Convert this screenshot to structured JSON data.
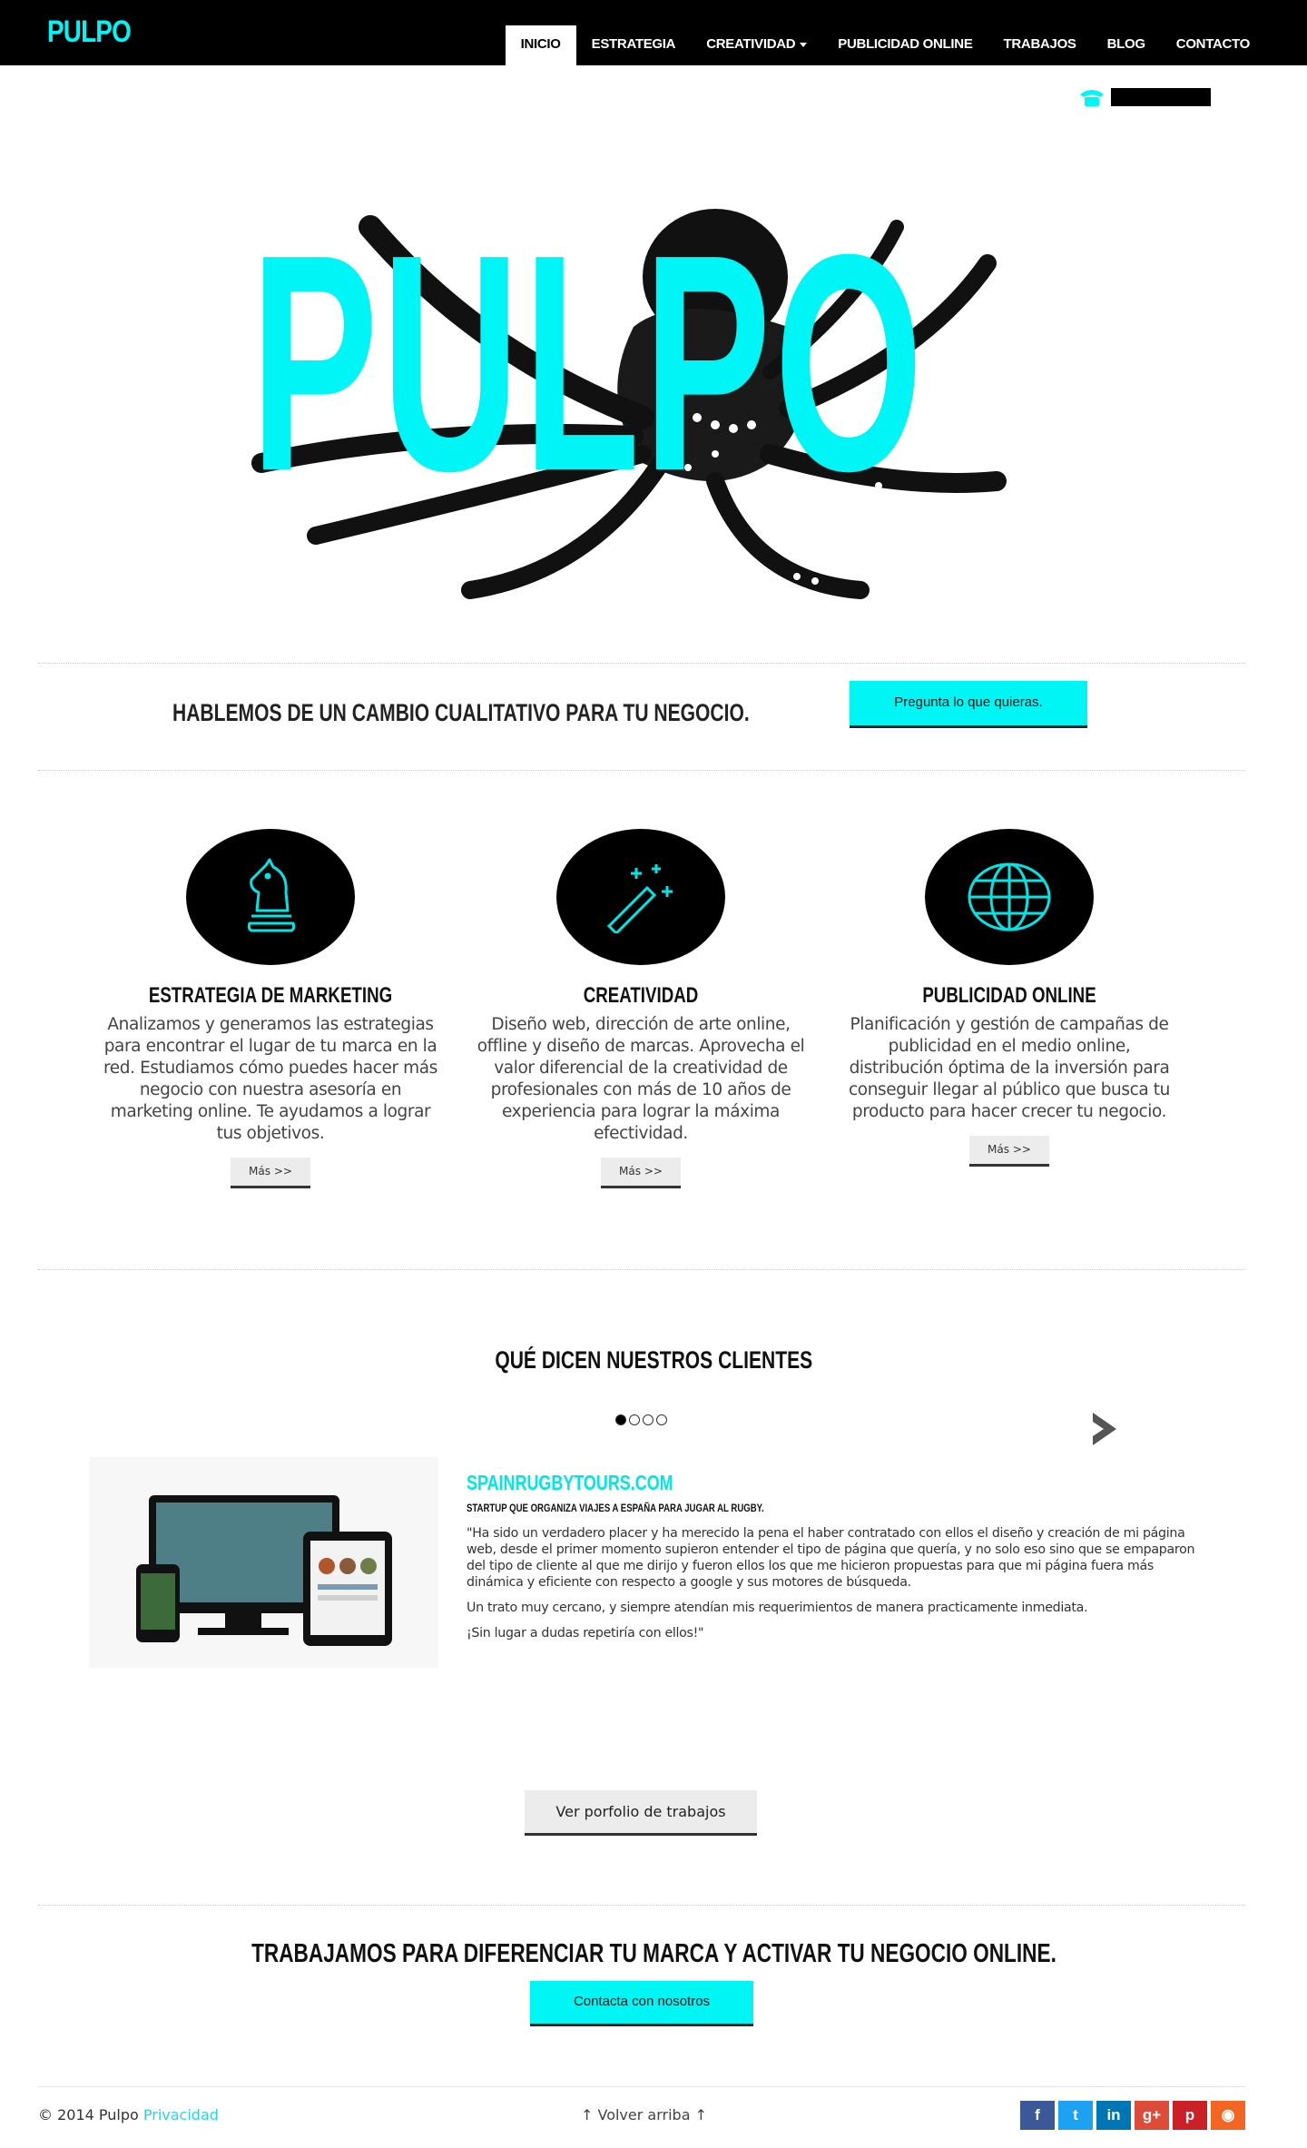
{
  "brand": "PULPO",
  "nav": {
    "items": [
      {
        "label": "INICIO",
        "active": true
      },
      {
        "label": "ESTRATEGIA"
      },
      {
        "label": "CREATIVIDAD",
        "dropdown": true
      },
      {
        "label": "PUBLICIDAD ONLINE"
      },
      {
        "label": "TRABAJOS"
      },
      {
        "label": "BLOG"
      },
      {
        "label": "CONTACTO"
      }
    ]
  },
  "hero": {
    "word": "PULPO"
  },
  "cta": {
    "text": "HABLEMOS DE UN CAMBIO CUALITATIVO PARA TU NEGOCIO.",
    "button": "Pregunta lo que quieras."
  },
  "services": [
    {
      "icon": "chess-knight-icon",
      "title": "ESTRATEGIA DE MARKETING",
      "desc": "Analizamos y generamos las estrategias para encontrar el lugar de tu marca en la red. Estudiamos cómo puedes hacer más negocio con nuestra asesoría en marketing online. Te ayudamos a lograr tus objetivos.",
      "button": "Más >>"
    },
    {
      "icon": "magic-wand-icon",
      "title": "CREATIVIDAD",
      "desc": "Diseño web, dirección de arte online, offline y diseño de marcas. Aprovecha el valor diferencial de la creatividad de profesionales con más de 10 años de experiencia para lograr la máxima efectividad.",
      "button": "Más >>"
    },
    {
      "icon": "globe-icon",
      "title": "PUBLICIDAD ONLINE",
      "desc": "Planificación y gestión de campañas de publicidad en el medio online, distribución óptima de la inversión para conseguir llegar al público que busca tu producto para hacer crecer tu negocio.",
      "button": "Más >>"
    }
  ],
  "testimonials": {
    "title": "QUÉ DICEN NUESTROS CLIENTES",
    "site": "SPAINRUGBYTOURS.COM",
    "subtitle": "STARTUP QUE ORGANIZA VIAJES A ESPAÑA PARA JUGAR AL RUGBY.",
    "quote": [
      "\"Ha sido un verdadero placer y ha merecido la pena el haber contratado con ellos el diseño y creación de mi página web, desde el primer momento supieron entender el tipo de página que quería, y no solo eso sino que se empaparon del tipo de cliente al que me dirijo y fueron ellos los que me hicieron propuestas para que mi página fuera más dinámica y eficiente con respecto a google y sus motores de búsqueda.",
      "Un trato muy cercano, y siempre atendían mis requerimientos de manera practicamente inmediata.",
      "¡Sin lugar a dudas repetiría con ellos!\""
    ],
    "portfolio_button": "Ver porfolio de trabajos"
  },
  "bottom": {
    "title": "TRABAJAMOS PARA DIFERENCIAR TU MARCA Y ACTIVAR TU NEGOCIO ONLINE.",
    "button": "Contacta con nosotros"
  },
  "footer": {
    "copyright": "© 2014 Pulpo",
    "privacy": "Privacidad",
    "back_to_top": "↑ Volver arriba ↑",
    "social": [
      {
        "name": "facebook-icon",
        "glyph": "f",
        "color": "#3b5998"
      },
      {
        "name": "twitter-icon",
        "glyph": "t",
        "color": "#1da1f2"
      },
      {
        "name": "linkedin-icon",
        "glyph": "in",
        "color": "#0077b5"
      },
      {
        "name": "google-plus-icon",
        "glyph": "g+",
        "color": "#dd4b39"
      },
      {
        "name": "pinterest-icon",
        "glyph": "p",
        "color": "#cb2027"
      },
      {
        "name": "rss-icon",
        "glyph": "◉",
        "color": "#f26522"
      }
    ]
  },
  "colors": {
    "accent": "#00f5f5",
    "nav_bg": "#000000"
  }
}
